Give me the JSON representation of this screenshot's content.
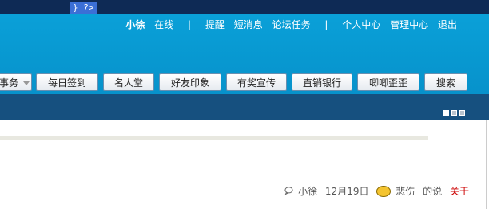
{
  "code_snippet": "} ?>",
  "user_nav": {
    "username": "小徐",
    "status": "在线",
    "separator1": "|",
    "remind": "提醒",
    "messages": "短消息",
    "tasks": "论坛任务",
    "separator2": "|",
    "personal_center": "个人中心",
    "admin_center": "管理中心",
    "logout": "退出"
  },
  "tabs": [
    {
      "label": "事务"
    },
    {
      "label": "每日签到"
    },
    {
      "label": "名人堂"
    },
    {
      "label": "好友印象"
    },
    {
      "label": "有奖宣传"
    },
    {
      "label": "直销银行"
    },
    {
      "label": "唧唧歪歪"
    },
    {
      "label": "搜索"
    }
  ],
  "post_meta": {
    "comment_icon": "comment-icon",
    "author": "小徐",
    "date": "12月19日",
    "mood_icon": "sad-face-icon",
    "mood": "悲伤",
    "says": "的说",
    "about": "关于"
  },
  "colors": {
    "topbar": "#0e2a55",
    "header": "#0aa0d8",
    "navbar": "#16507f",
    "about_link": "#cc0000"
  }
}
